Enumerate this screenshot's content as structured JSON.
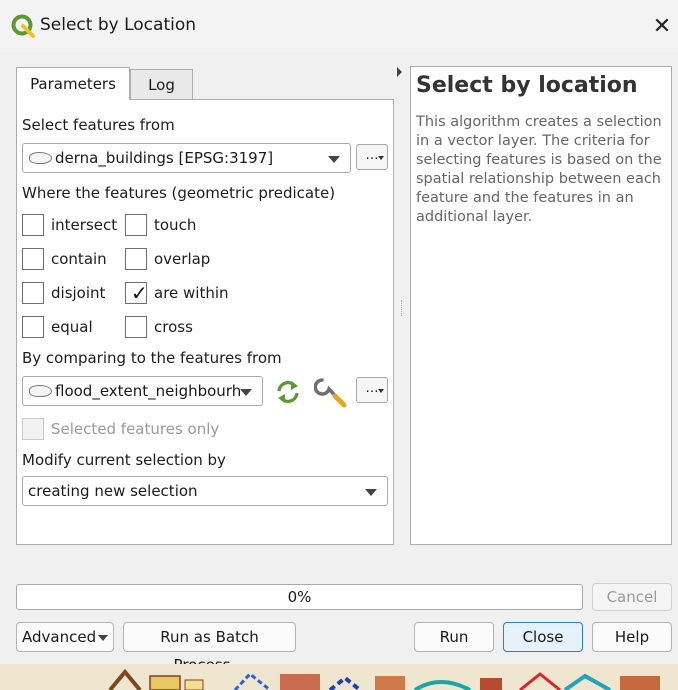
{
  "window": {
    "title": "Select by Location",
    "close_glyph": "✕"
  },
  "tabs": [
    {
      "label": "Parameters",
      "active": true
    },
    {
      "label": "Log",
      "active": false
    }
  ],
  "params": {
    "select_from_label": "Select features from",
    "select_from_value": "derna_buildings [EPSG:3197]",
    "predicate_label": "Where the features (geometric predicate)",
    "predicates": [
      {
        "label": "intersect",
        "checked": false
      },
      {
        "label": "touch",
        "checked": false
      },
      {
        "label": "contain",
        "checked": false
      },
      {
        "label": "overlap",
        "checked": false
      },
      {
        "label": "disjoint",
        "checked": false
      },
      {
        "label": "are within",
        "checked": true
      },
      {
        "label": "equal",
        "checked": false
      },
      {
        "label": "cross",
        "checked": false
      }
    ],
    "compare_label": "By comparing to the features from",
    "compare_value": "flood_extent_neighbourh",
    "selected_only_label": "Selected features only",
    "modify_label": "Modify current selection by",
    "modify_value": "creating new selection",
    "more_button": "…",
    "check_glyph": "✓"
  },
  "help": {
    "title": "Select by location",
    "body": "This algorithm creates a selection in a vector layer. The criteria for selecting features is based on the spatial relationship between each feature and the features in an additional layer."
  },
  "progress": {
    "text": "0%",
    "value": 0
  },
  "buttons": {
    "cancel": "Cancel",
    "advanced": "Advanced",
    "batch": "Run as Batch Process…",
    "run": "Run",
    "close": "Close",
    "help": "Help"
  },
  "colors": {
    "accent": "#2c7fd0",
    "qgis_green": "#5b9a32",
    "qgis_yellow": "#f0c419"
  },
  "icons": [
    "qgis-logo-icon",
    "refresh-icon",
    "wrench-icon",
    "layer-polygon-icon",
    "collapse-arrow-icon"
  ]
}
